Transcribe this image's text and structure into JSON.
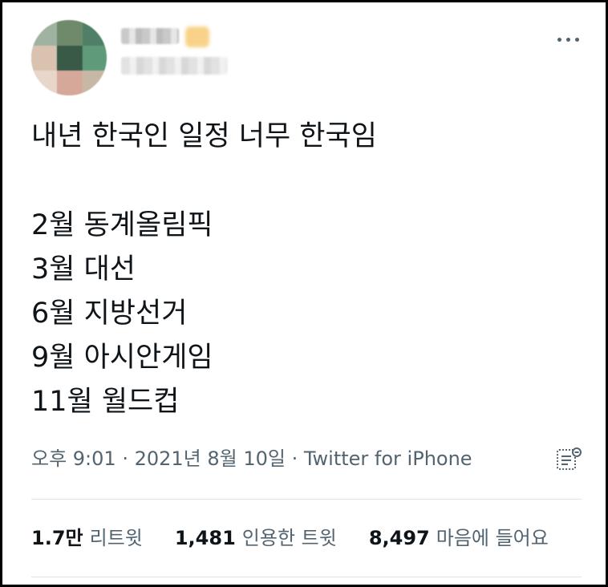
{
  "tweet": {
    "text_lines": [
      "내년 한국인 일정 너무 한국임",
      "",
      "2월 동계올림픽",
      "3월 대선",
      "6월 지방선거",
      "9월 아시안게임",
      "11월 월드컵"
    ],
    "meta": {
      "time": "오후 9:01",
      "separator1": " · ",
      "date": "2021년 8월 10일",
      "separator2": " · ",
      "source": "Twitter for iPhone"
    },
    "stats": {
      "retweets": {
        "value": "1.7만",
        "label": "리트윗"
      },
      "quotes": {
        "value": "1,481",
        "label": "인용한 트윗"
      },
      "likes": {
        "value": "8,497",
        "label": "마음에 들어요"
      }
    }
  },
  "icons": {
    "more": "more-horizontal-icon",
    "analytics": "analytics-icon"
  },
  "colors": {
    "text": "#0f1419",
    "secondary": "#536471",
    "divider": "#dfe3e7"
  }
}
